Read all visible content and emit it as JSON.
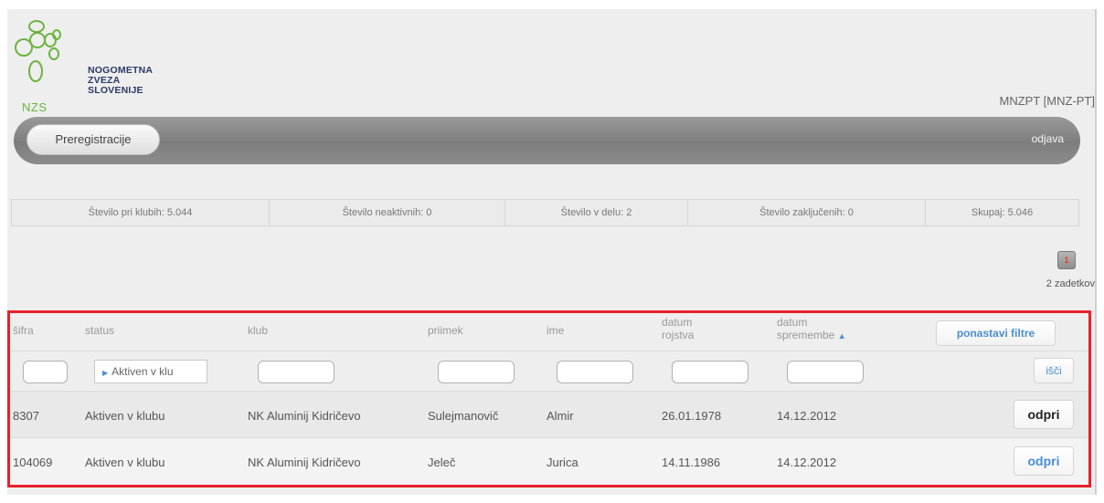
{
  "header": {
    "logo_lines": [
      "NOGOMETNA",
      "ZVEZA",
      "SLOVENIJE"
    ],
    "logo_abbr": "NZS",
    "user": "MNZPT [MNZ-PT]",
    "brand_green": "#6cb33f",
    "brand_navy": "#2b3a67"
  },
  "nav": {
    "primary": "Preregistracije",
    "logout": "odjava"
  },
  "stats": [
    "Število pri klubih: 5.044",
    "Število neaktivnih: 0",
    "Število v delu: 2",
    "Število zaključenih: 0",
    "Skupaj: 5.046"
  ],
  "pager": {
    "page": "1",
    "results": "2 zadetkov"
  },
  "table": {
    "headers": {
      "code": "šifra",
      "status": "status",
      "club": "klub",
      "surname": "priimek",
      "name": "ime",
      "birth_1": "datum",
      "birth_2": "rojstva",
      "changed_1": "datum",
      "changed_2": "spremembe",
      "sort_icon": "chevron-up-icon"
    },
    "reset_label": "ponastavi filtre",
    "search_label": "išči",
    "status_filter": "Aktiven v klu",
    "open_label": "odpri",
    "rows": [
      {
        "code": "8307",
        "status": "Aktiven v klubu",
        "club": "NK Aluminij Kidričevo",
        "surname": "Sulejmanovič",
        "name": "Almir",
        "birth": "26.01.1978",
        "changed": "14.12.2012"
      },
      {
        "code": "104069",
        "status": "Aktiven v klubu",
        "club": "NK Aluminij Kidričevo",
        "surname": "Jeleč",
        "name": "Jurica",
        "birth": "14.11.1986",
        "changed": "14.12.2012"
      }
    ]
  }
}
